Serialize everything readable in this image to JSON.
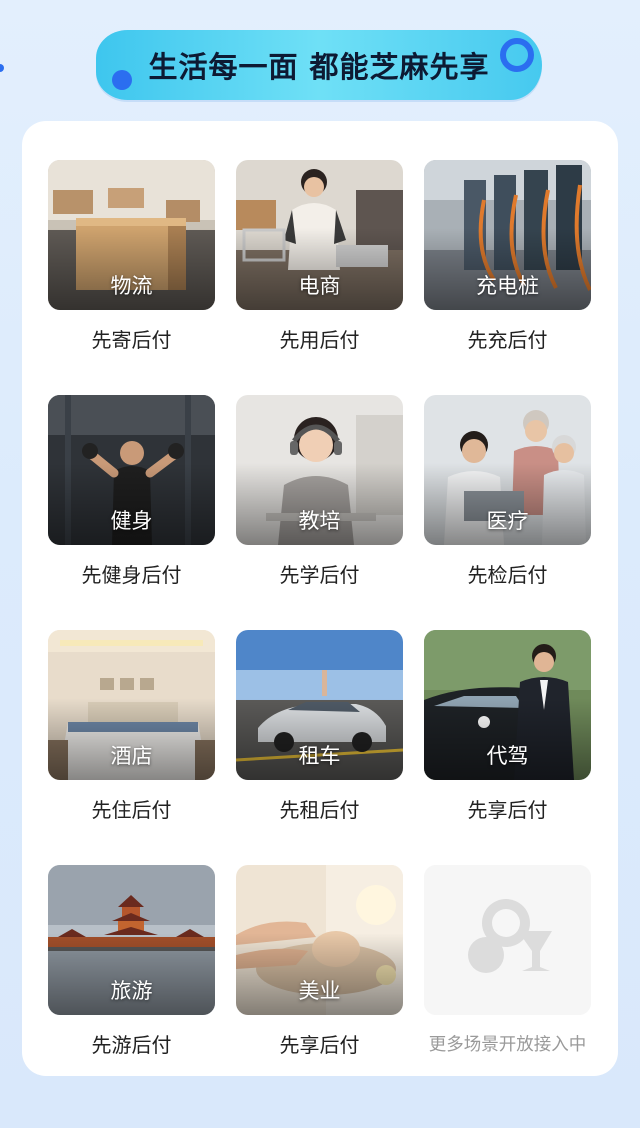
{
  "banner": {
    "title": "生活每一面 都能芝麻先享"
  },
  "colors": {
    "accent": "#2b6ef0",
    "banner": "#4fd0f0",
    "caption": "#222222",
    "muted": "#9a9a9a"
  },
  "scenes": [
    {
      "label": "物流",
      "caption": "先寄后付",
      "icon": "logistics-photo"
    },
    {
      "label": "电商",
      "caption": "先用后付",
      "icon": "ecommerce-photo"
    },
    {
      "label": "充电桩",
      "caption": "先充后付",
      "icon": "charging-pile-photo"
    },
    {
      "label": "健身",
      "caption": "先健身后付",
      "icon": "fitness-photo"
    },
    {
      "label": "教培",
      "caption": "先学后付",
      "icon": "education-photo"
    },
    {
      "label": "医疗",
      "caption": "先检后付",
      "icon": "medical-photo"
    },
    {
      "label": "酒店",
      "caption": "先住后付",
      "icon": "hotel-photo"
    },
    {
      "label": "租车",
      "caption": "先租后付",
      "icon": "car-rental-photo"
    },
    {
      "label": "代驾",
      "caption": "先享后付",
      "icon": "designated-driver-photo"
    },
    {
      "label": "旅游",
      "caption": "先游后付",
      "icon": "travel-photo"
    },
    {
      "label": "美业",
      "caption": "先享后付",
      "icon": "beauty-photo"
    }
  ],
  "more": {
    "caption": "更多场景开放接入中",
    "icon": "sesame-logo-icon"
  }
}
